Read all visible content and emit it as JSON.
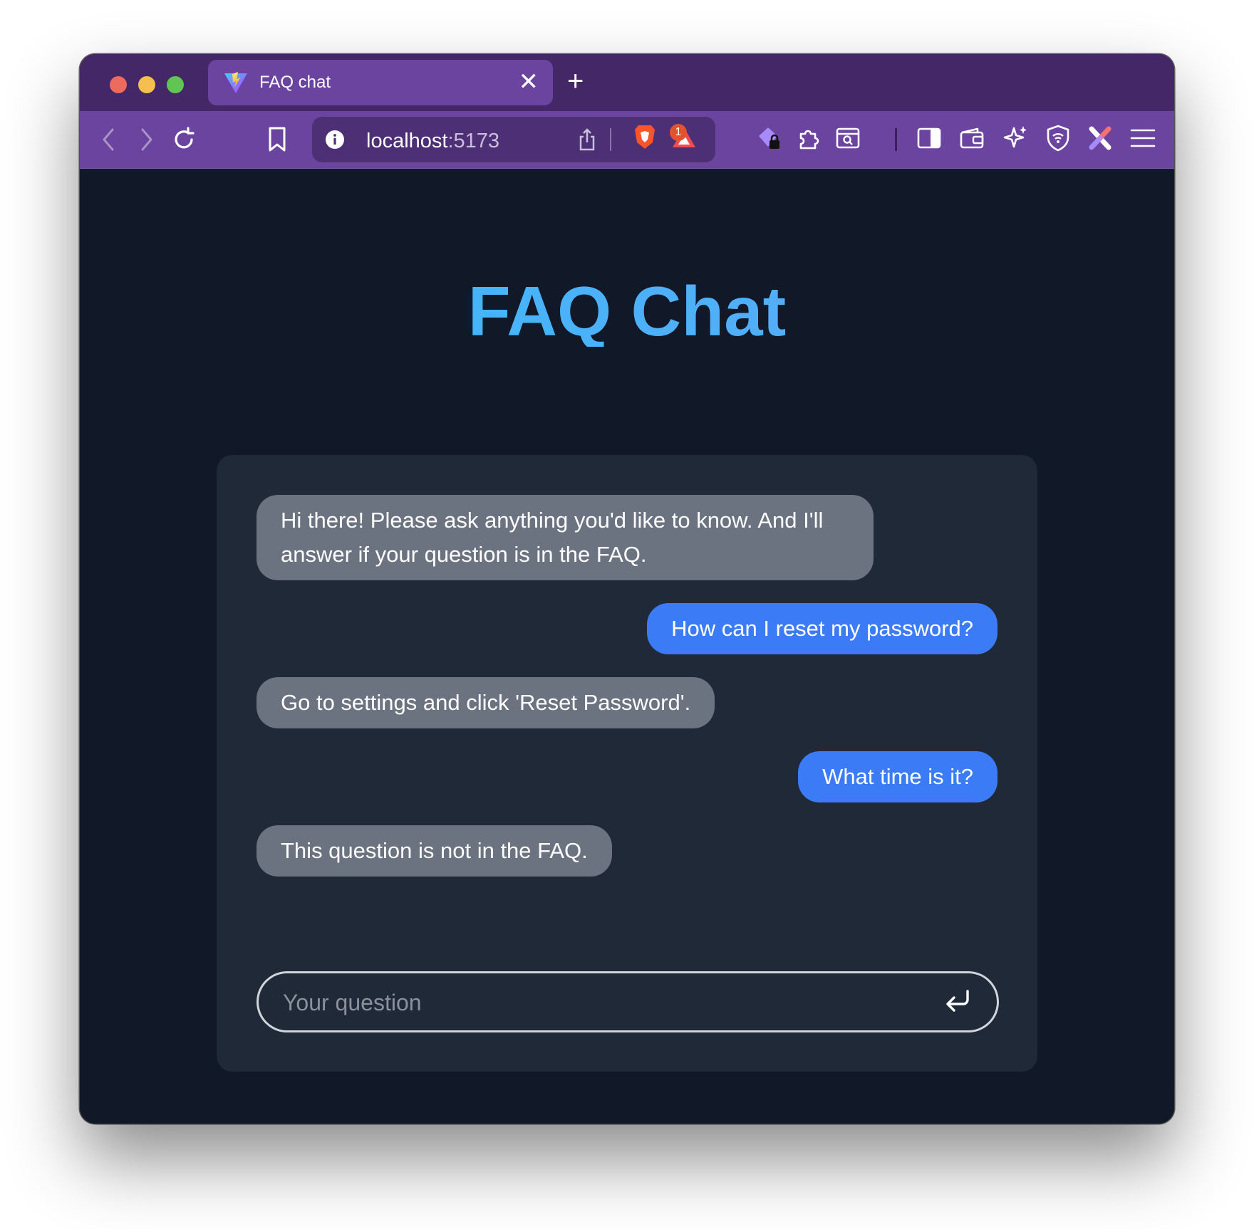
{
  "browser": {
    "tab": {
      "title": "FAQ chat",
      "close": "✕"
    },
    "new_tab": "+",
    "url": {
      "host": "localhost",
      "port": ":5173"
    },
    "notification_count": "1"
  },
  "page": {
    "title": "FAQ Chat"
  },
  "chat": {
    "messages": [
      {
        "role": "bot",
        "text": "Hi there! Please ask anything you'd like to know. And I'll answer if your question is in the FAQ."
      },
      {
        "role": "user",
        "text": "How can I reset my password?"
      },
      {
        "role": "bot",
        "text": "Go to settings and click 'Reset Password'."
      },
      {
        "role": "user",
        "text": "What time is it?"
      },
      {
        "role": "bot",
        "text": "This question is not in the FAQ."
      }
    ],
    "input": {
      "placeholder": "Your question",
      "value": ""
    }
  },
  "colors": {
    "tabbar": "#432766",
    "toolbar": "#6b44a0",
    "page_bg": "#111827",
    "panel_bg": "#1f2937",
    "bot_bubble": "#6b7280",
    "user_bubble": "#3b7bf6",
    "title_gradient_start": "#38bdf8",
    "title_gradient_end": "#60a5fa"
  },
  "icons": [
    "back-icon",
    "forward-icon",
    "reload-icon",
    "bookmark-icon",
    "site-info-icon",
    "share-icon",
    "brave-shields-icon",
    "brave-rewards-icon",
    "password-lock-icon",
    "extensions-icon",
    "page-search-icon",
    "sidebar-icon",
    "wallet-icon",
    "leo-ai-icon",
    "vpn-icon",
    "extension-x-icon",
    "menu-icon",
    "enter-icon"
  ]
}
